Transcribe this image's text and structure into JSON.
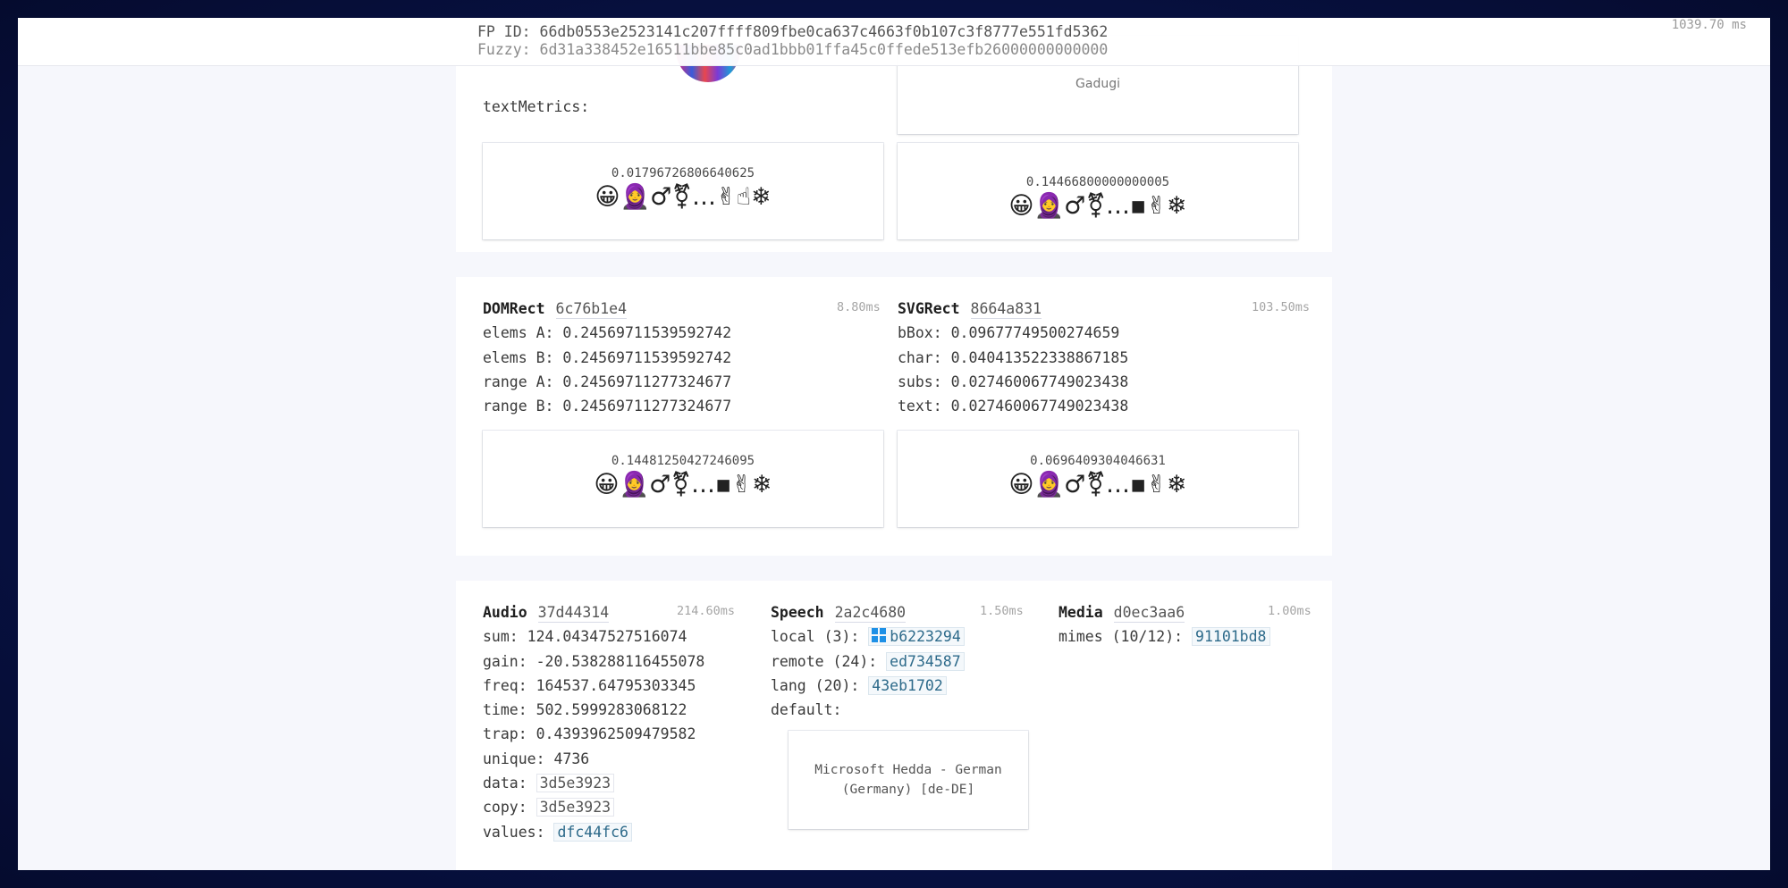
{
  "header": {
    "fp_id": "FP ID: 66db0553e2523141c207ffff809fbe0ca637c4663f0b107c3f8777e551fd5362",
    "fuzzy": "Fuzzy: 6d31a338452e16511bbe85c0ad1bbb01ffa45c0ffede513efb26000000000000",
    "total_time": "1039.70 ms"
  },
  "top_section": {
    "text_metrics_label": "textMetrics:",
    "partial_text": "Gadugi",
    "cards": [
      {
        "value": "0.01796726806640625",
        "emoji": "😀🧕♂⚧…✌☝❄"
      },
      {
        "value": "0.14466800000000005",
        "emoji": "😀🧕♂⚧…▪✌❄"
      }
    ]
  },
  "domrect": {
    "title": "DOMRect",
    "hash": "6c76b1e4",
    "time": "8.80ms",
    "rows": [
      "elems A: 0.24569711539592742",
      "elems B: 0.24569711539592742",
      "range A: 0.24569711277324677",
      "range B: 0.24569711277324677"
    ],
    "card": {
      "value": "0.14481250427246095",
      "emoji": "😀🧕♂⚧…▪✌❄"
    }
  },
  "svgrect": {
    "title": "SVGRect",
    "hash": "8664a831",
    "time": "103.50ms",
    "rows": [
      "bBox: 0.09677749500274659",
      "char: 0.040413522338867185",
      "subs: 0.027460067749023438",
      "text: 0.027460067749023438"
    ],
    "card": {
      "value": "0.0696409304046631",
      "emoji": "😀🧕♂⚧…▪✌❄"
    }
  },
  "audio": {
    "title": "Audio",
    "hash": "37d44314",
    "time": "214.60ms",
    "rows": [
      "sum: 124.04347527516074",
      "gain: -20.538288116455078",
      "freq: 164537.64795303345",
      "time: 502.5999283068122",
      "trap: 0.4393962509479582",
      "unique: 4736"
    ],
    "data_label": "data:",
    "data_value": "3d5e3923",
    "copy_label": "copy:",
    "copy_value": "3d5e3923",
    "values_label": "values:",
    "values_value": "dfc44fc6"
  },
  "speech": {
    "title": "Speech",
    "hash": "2a2c4680",
    "time": "1.50ms",
    "local_label": "local (3):",
    "local_value": "b6223294",
    "local_icon": "windows-icon",
    "remote_label": "remote (24):",
    "remote_value": "ed734587",
    "lang_label": "lang (20):",
    "lang_value": "43eb1702",
    "default_label": "default:",
    "default_voice": "Microsoft Hedda - German (Germany) [de-DE]"
  },
  "media": {
    "title": "Media",
    "hash": "d0ec3aa6",
    "time": "1.00ms",
    "mimes_label": "mimes (10/12):",
    "mimes_value": "91101bd8"
  }
}
